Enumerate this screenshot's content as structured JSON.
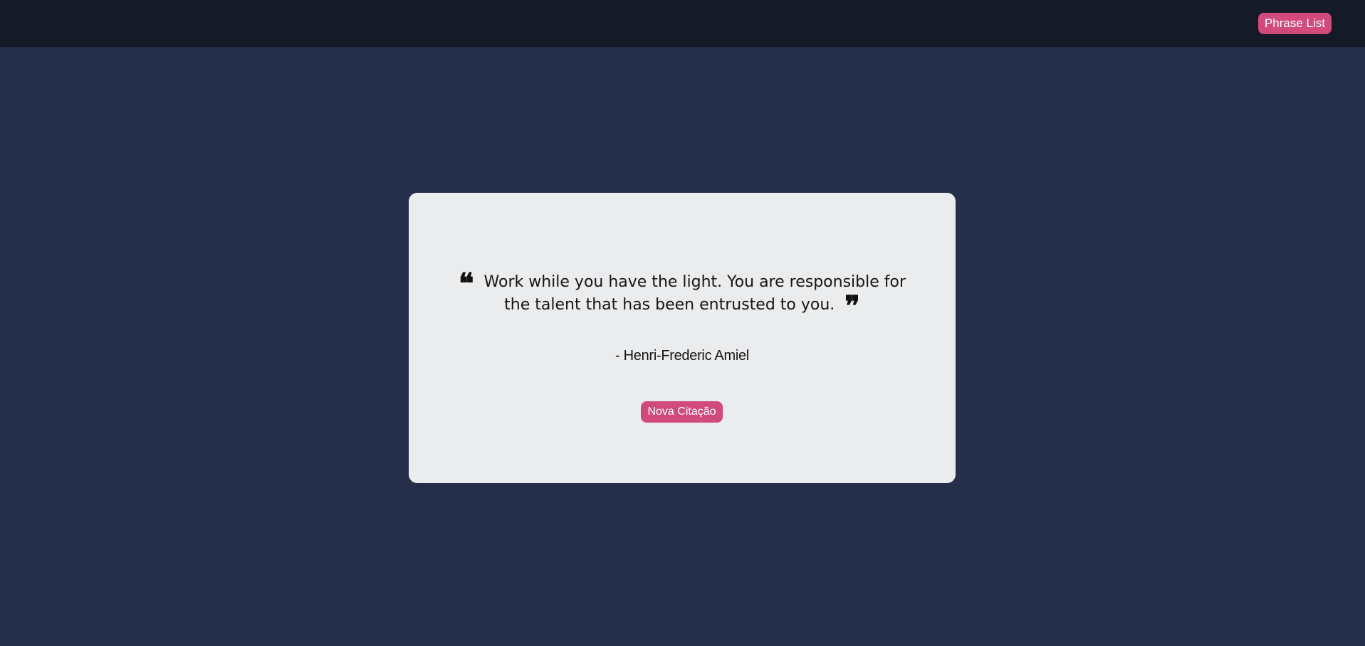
{
  "header": {
    "phrase_list_label": "Phrase List"
  },
  "quote": {
    "open_mark": "❝",
    "text": "Work while you have the light. You are responsible for the talent that has been entrusted to you.",
    "close_mark": "❞",
    "author": "- Henri-Frederic Amiel"
  },
  "actions": {
    "new_quote_label": "Nova Citação"
  },
  "colors": {
    "background": "#252f49",
    "header": "#151a29",
    "card": "#ebecee",
    "accent": "#d14a7b"
  }
}
